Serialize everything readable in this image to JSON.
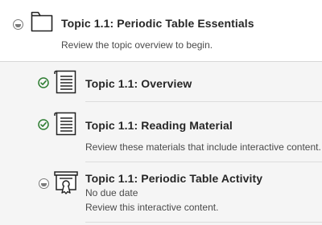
{
  "folder": {
    "title": "Topic 1.1: Periodic Table Essentials",
    "description": "Review the topic overview to begin.",
    "icon": "folder-icon",
    "status": "hidden"
  },
  "items": [
    {
      "title": "Topic 1.1: Overview",
      "status": "completed",
      "icon": "document-icon"
    },
    {
      "title": "Topic 1.1: Reading Material",
      "description": "Review these materials that include interactive content.",
      "status": "completed",
      "icon": "document-icon"
    },
    {
      "title": "Topic 1.1: Periodic Table Activity",
      "due": "No due date",
      "description": "Review this interactive content.",
      "status": "hidden",
      "icon": "interactive-activity-icon"
    }
  ],
  "colors": {
    "completed": "#2e7d32",
    "hidden": "#7a7a7a",
    "background": "#f5f5f5"
  }
}
